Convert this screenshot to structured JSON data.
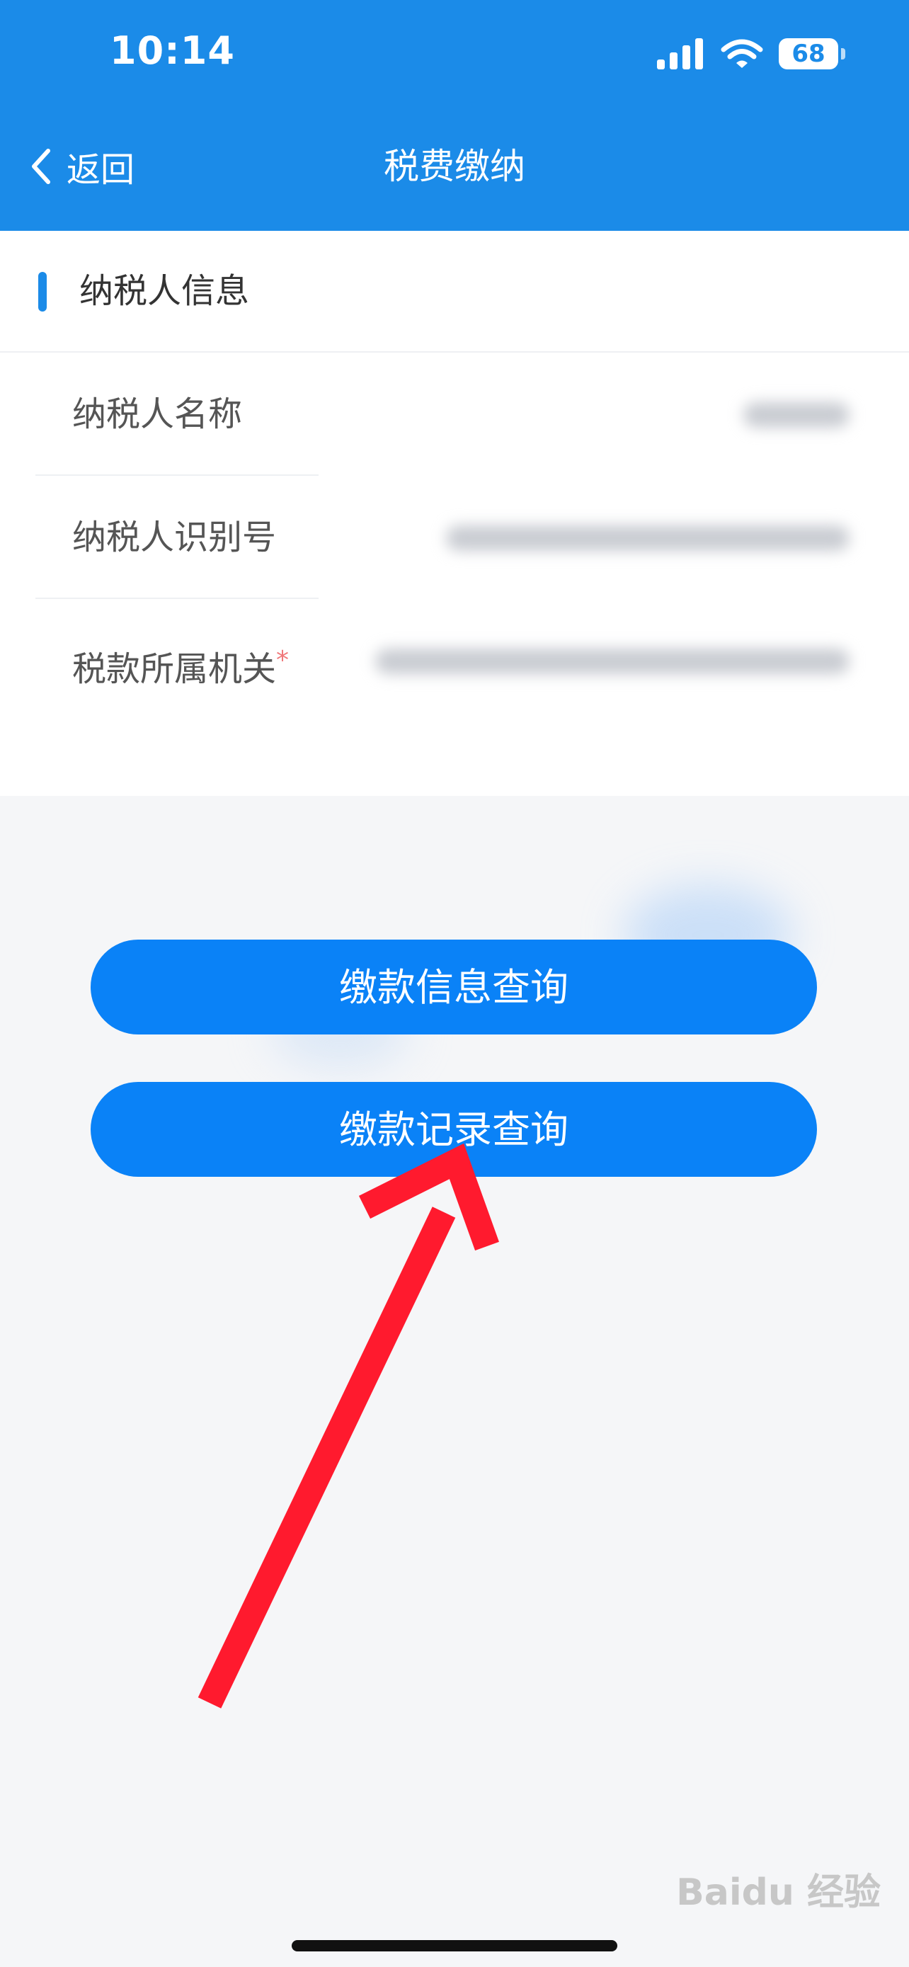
{
  "status_bar": {
    "time": "10:14",
    "battery": "68"
  },
  "nav": {
    "back_label": "返回",
    "title": "税费缴纳"
  },
  "section": {
    "title": "纳税人信息"
  },
  "fields": [
    {
      "label": "纳税人名称",
      "required": false
    },
    {
      "label": "纳税人识别号",
      "required": false
    },
    {
      "label": "税款所属机关",
      "required": true,
      "required_mark": "*"
    }
  ],
  "buttons": {
    "payment_info_query": "缴款信息查询",
    "payment_record_query": "缴款记录查询"
  },
  "watermark": "Baidu 经验",
  "colors": {
    "primary": "#1b8be8",
    "button": "#0a82f7",
    "arrow": "#ff1a2e",
    "background": "#f5f6f8"
  },
  "icons": [
    "signal-icon",
    "wifi-icon",
    "battery-icon",
    "back-chevron-icon"
  ]
}
